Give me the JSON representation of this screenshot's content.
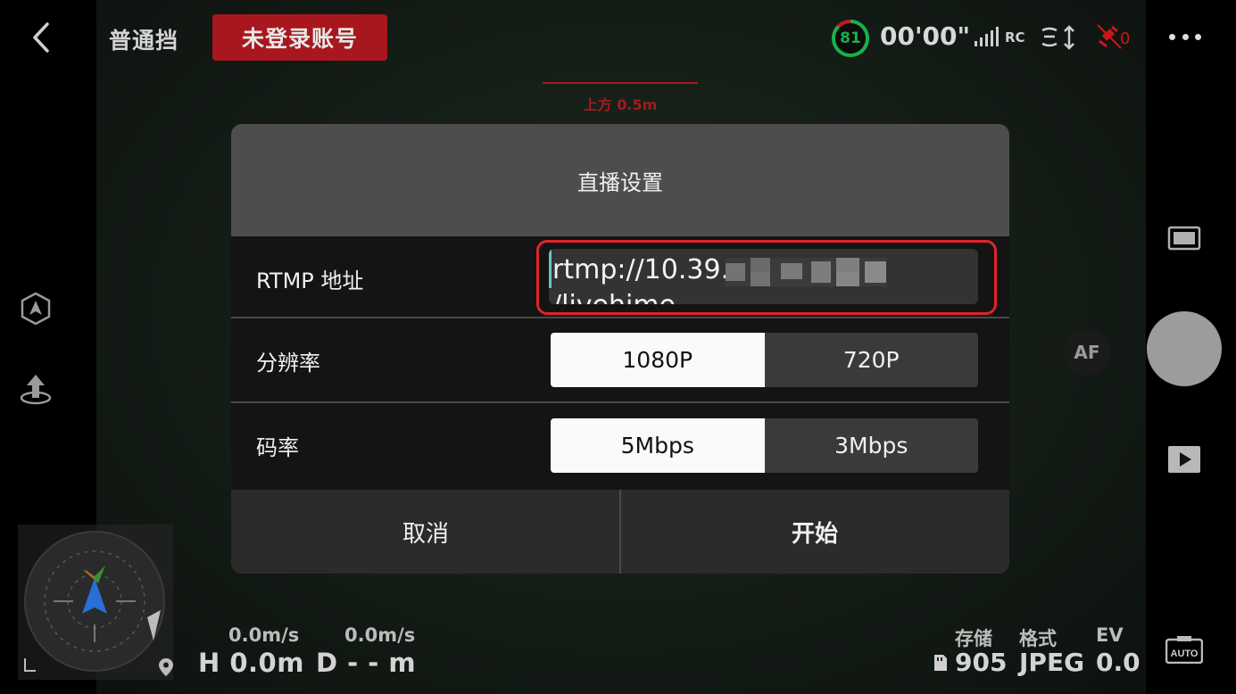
{
  "top_bar": {
    "flight_mode": "普通挡",
    "login_badge": "未登录账号",
    "battery_percent": "81",
    "flight_time": "00'00\"",
    "rc_label": "RC",
    "gps_count": "0"
  },
  "obstacle_warning": {
    "text": "上方 0.5m"
  },
  "telemetry": {
    "horizontal_speed": "0.0m/s",
    "vertical_speed": "0.0m/s",
    "height": "H 0.0m",
    "distance": "D - - m"
  },
  "camera_info": {
    "storage_label": "存储",
    "storage_value": "905",
    "format_label": "格式",
    "format_value": "JPEG",
    "ev_label": "EV",
    "ev_value": "0.0"
  },
  "right_controls": {
    "af_label": "AF",
    "auto_label": "AUTO"
  },
  "dialog": {
    "title": "直播设置",
    "rtmp": {
      "label": "RTMP 地址",
      "value_line1": "rtmp://10.39.",
      "value_line2": "/livehime"
    },
    "resolution": {
      "label": "分辨率",
      "options": [
        "1080P",
        "720P"
      ],
      "selected": "1080P"
    },
    "bitrate": {
      "label": "码率",
      "options": [
        "5Mbps",
        "3Mbps"
      ],
      "selected": "5Mbps"
    },
    "cancel_label": "取消",
    "start_label": "开始"
  },
  "colors": {
    "accent_red": "#a8171d",
    "battery_green": "#19b04a",
    "highlight_red": "#e0242a",
    "caret_teal": "#69c3c7"
  },
  "icons": {
    "back": "chevron-left-icon",
    "battery": "battery-ring-icon",
    "signal": "rc-signal-icon",
    "vision": "vision-sensor-icon",
    "gps": "gps-icon",
    "more": "more-dots-icon",
    "smart": "smart-track-icon",
    "takeoff": "takeoff-icon",
    "photo_mode": "photo-mode-icon",
    "playback": "playback-icon",
    "auto": "auto-exposure-icon",
    "map": "location-pin-icon",
    "sd": "sd-card-icon"
  }
}
